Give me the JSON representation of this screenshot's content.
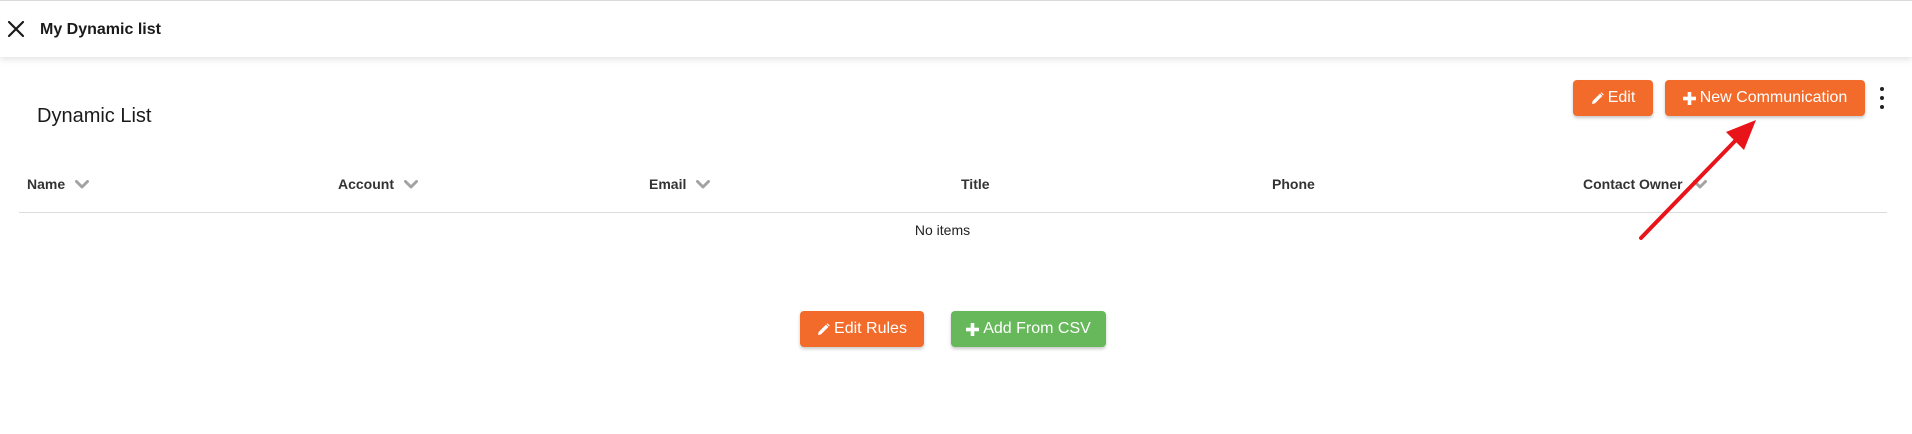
{
  "window": {
    "title": "My Dynamic list",
    "close_icon": "close-icon"
  },
  "section": {
    "title": "Dynamic List"
  },
  "toolbar": {
    "edit_label": "Edit",
    "edit_icon": "pencil-icon",
    "new_communication_label": "New Communication",
    "new_communication_icon": "plus-icon",
    "more_icon": "kebab-menu-icon"
  },
  "table": {
    "columns": [
      {
        "label": "Name",
        "sortable": true
      },
      {
        "label": "Account",
        "sortable": true
      },
      {
        "label": "Email",
        "sortable": true
      },
      {
        "label": "Title",
        "sortable": false
      },
      {
        "label": "Phone",
        "sortable": false
      },
      {
        "label": "Contact Owner",
        "sortable": true
      }
    ],
    "empty_message": "No items"
  },
  "actions": {
    "edit_rules_label": "Edit Rules",
    "edit_rules_icon": "pencil-icon",
    "add_csv_label": "Add From CSV",
    "add_csv_icon": "plus-icon"
  },
  "colors": {
    "accent_orange": "#f26b2b",
    "accent_green": "#66b85a",
    "annotation_red": "#e8141a"
  }
}
